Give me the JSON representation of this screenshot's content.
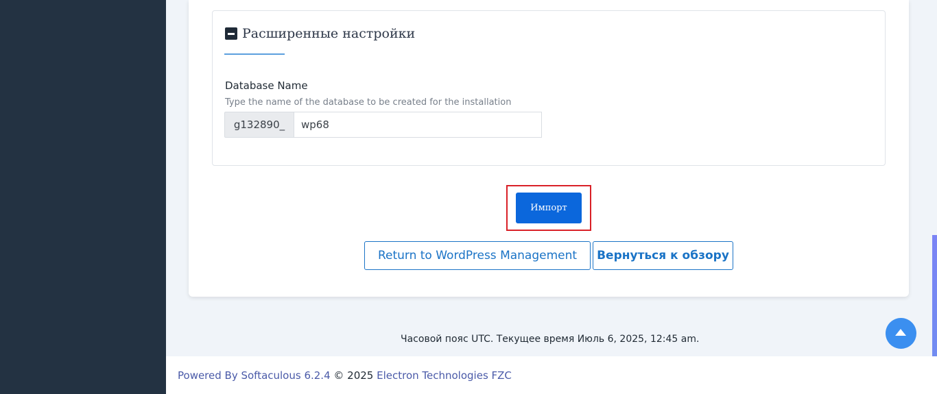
{
  "advanced_settings": {
    "title": "Расширенные настройки",
    "database_name": {
      "label": "Database Name",
      "help": "Type the name of the database to be created for the installation",
      "prefix": "g132890_",
      "value": "wp68"
    }
  },
  "actions": {
    "import_label": "Импорт",
    "return_label": "Return to WordPress Management",
    "overview_label": "Вернуться к обзору"
  },
  "timezone_text": "Часовой пояс UTC. Текущее время Июль 6, 2025, 12:45 am.",
  "footer": {
    "powered_by": "Powered By Softaculous 6.2.4",
    "copyright": " © 2025 ",
    "company": "Electron Technologies FZC"
  },
  "icons": {
    "collapse": "minus-square-icon",
    "scroll_top": "arrow-up-icon"
  },
  "colors": {
    "sidebar": "#233242",
    "primary": "#0b67dc",
    "highlight": "#d92027"
  }
}
